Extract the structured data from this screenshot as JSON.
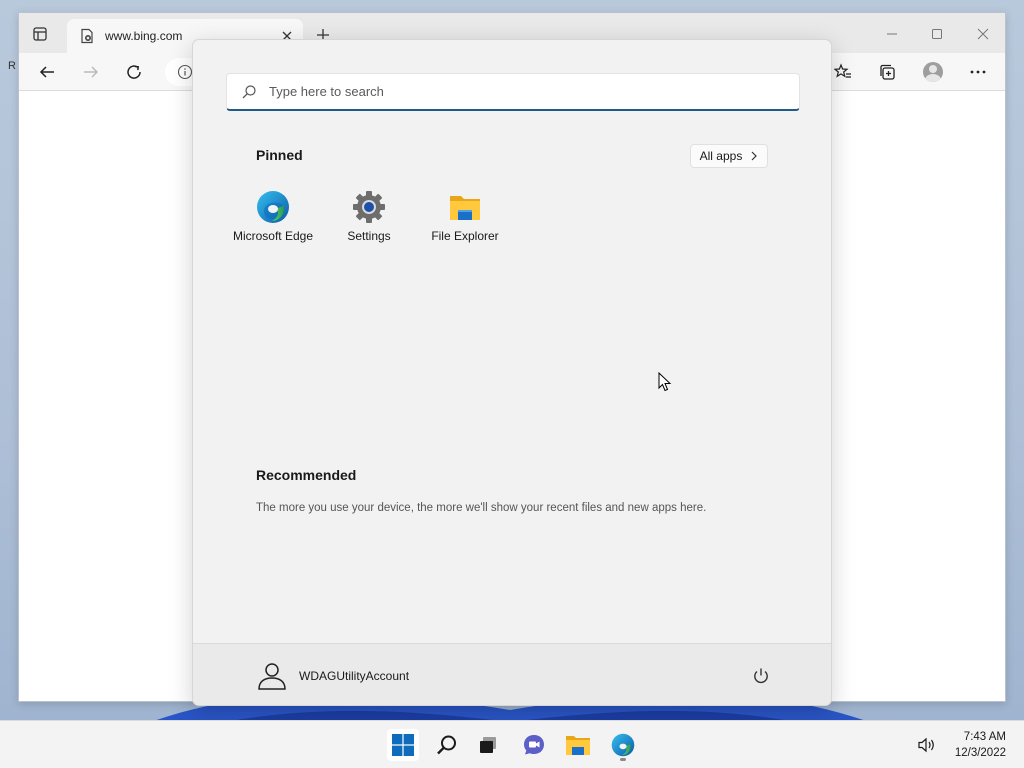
{
  "browser": {
    "tab": {
      "title": "www.bing.com"
    },
    "left_edge_text": "R"
  },
  "start_menu": {
    "search": {
      "placeholder": "Type here to search"
    },
    "pinned": {
      "title": "Pinned",
      "all_apps_label": "All apps",
      "apps": [
        {
          "label": "Microsoft Edge",
          "icon": "edge-icon"
        },
        {
          "label": "Settings",
          "icon": "gear-icon"
        },
        {
          "label": "File Explorer",
          "icon": "folder-icon"
        }
      ]
    },
    "recommended": {
      "title": "Recommended",
      "empty_text": "The more you use your device, the more we'll show your recent files and new apps here."
    },
    "footer": {
      "user_name": "WDAGUtilityAccount"
    }
  },
  "taskbar": {
    "icons": [
      "start-icon",
      "search-icon",
      "task-view-icon",
      "chat-icon",
      "file-explorer-icon",
      "edge-icon"
    ],
    "clock": {
      "time": "7:43 AM",
      "date": "12/3/2022"
    }
  },
  "colors": {
    "search_underline": "#1e5a8a",
    "start_accent": "#0f6cbd"
  }
}
